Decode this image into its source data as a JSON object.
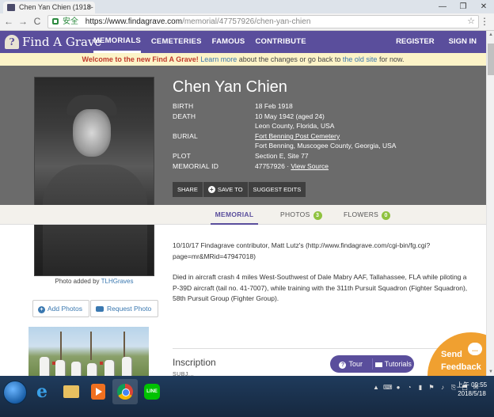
{
  "browser": {
    "tab_title": "Chen Yan Chien (1918-",
    "tab_close": "×",
    "window_controls": [
      "—",
      "❐",
      "✕"
    ],
    "nav_back": "←",
    "nav_forward": "→",
    "nav_reload": "C",
    "secure_label": "安全",
    "url_main": "https://www.findagrave.com",
    "url_rest": "/memorial/47757926/chen-yan-chien",
    "star": "☆",
    "menu": "⋮"
  },
  "site": {
    "logo_text": "Find A Grave",
    "logo_glyph": "?",
    "nav": [
      "MEMORIALS",
      "CEMETERIES",
      "FAMOUS",
      "CONTRIBUTE"
    ],
    "register": "REGISTER",
    "signin": "SIGN IN"
  },
  "banner": {
    "welcome": "Welcome to the new Find A Grave!",
    "learn_more": "Learn more",
    "mid": "about the changes or go back to",
    "old_site": "the old site",
    "end": "for now."
  },
  "memorial": {
    "name": "Chen Yan Chien",
    "facts": [
      {
        "label": "BIRTH",
        "value": "18 Feb 1918"
      },
      {
        "label": "DEATH",
        "value": "10 May 1942 (aged 24)"
      },
      {
        "label": "",
        "value": "Leon County, Florida, USA"
      },
      {
        "label": "BURIAL",
        "value": "Fort Benning Post Cemetery",
        "link": true
      },
      {
        "label": "",
        "value": "Fort Benning, Muscogee County, Georgia, USA"
      },
      {
        "label": "PLOT",
        "value": "Section E, Site 77"
      }
    ],
    "memorial_id_label": "MEMORIAL ID",
    "memorial_id": "47757926",
    "id_sep": " · ",
    "view_source": "View Source",
    "actions": {
      "share": "SHARE",
      "save": "SAVE TO",
      "plus": "+",
      "suggest": "SUGGEST EDITS"
    },
    "photo_caption_prefix": "Photo added by",
    "photo_caption_user": "TLHGraves"
  },
  "tabs": {
    "memorial": "MEMORIAL",
    "photos": "PHOTOS",
    "photos_count": "3",
    "flowers": "FLOWERS",
    "flowers_count": "0"
  },
  "bio": {
    "p1": "10/10/17 Findagrave contributor, Matt Lutz's (http://www.findagrave.com/cgi-bin/fg.cgi?page=mr&MRid=47947018)",
    "p2": "Died in aircraft crash 4 miles West-Southwest of Dale Mabry AAF, Tallahassee, FLA while piloting a P-39D aircraft (tail no. 41-7007), while training with the 311th Pursuit Squadron (Fighter Squadron), 58th Pursuit Group (Fighter Group)."
  },
  "buttons": {
    "add_photos": "Add Photos",
    "add_icon": "+",
    "request_photo": "Request Photo"
  },
  "inscription": {
    "title": "Inscription",
    "sub": "SUBJ..."
  },
  "help_pill": {
    "tour": "Tour",
    "tour_icon": "?",
    "tutorials": "Tutorials"
  },
  "feedback": {
    "line1": "Send",
    "line2": "Feedback",
    "icon": "..."
  },
  "scroll": {
    "up": "▲",
    "down": "▼"
  },
  "taskbar": {
    "line_label": "LINE",
    "ie_glyph": "e",
    "tray": [
      "▲",
      "⌨",
      "●",
      "◔",
      "▮",
      "⚑",
      "♪",
      "⎘",
      "⬒",
      "✉"
    ],
    "time": "上午 09:55",
    "date": "2018/5/18"
  },
  "colors": {
    "nav_purple": "#5a4e9c",
    "hero_gray": "#6b6b6b",
    "banner_yellow": "#fcf3c7",
    "badge_green": "#8fc23f",
    "feedback_orange": "#f0a030"
  }
}
